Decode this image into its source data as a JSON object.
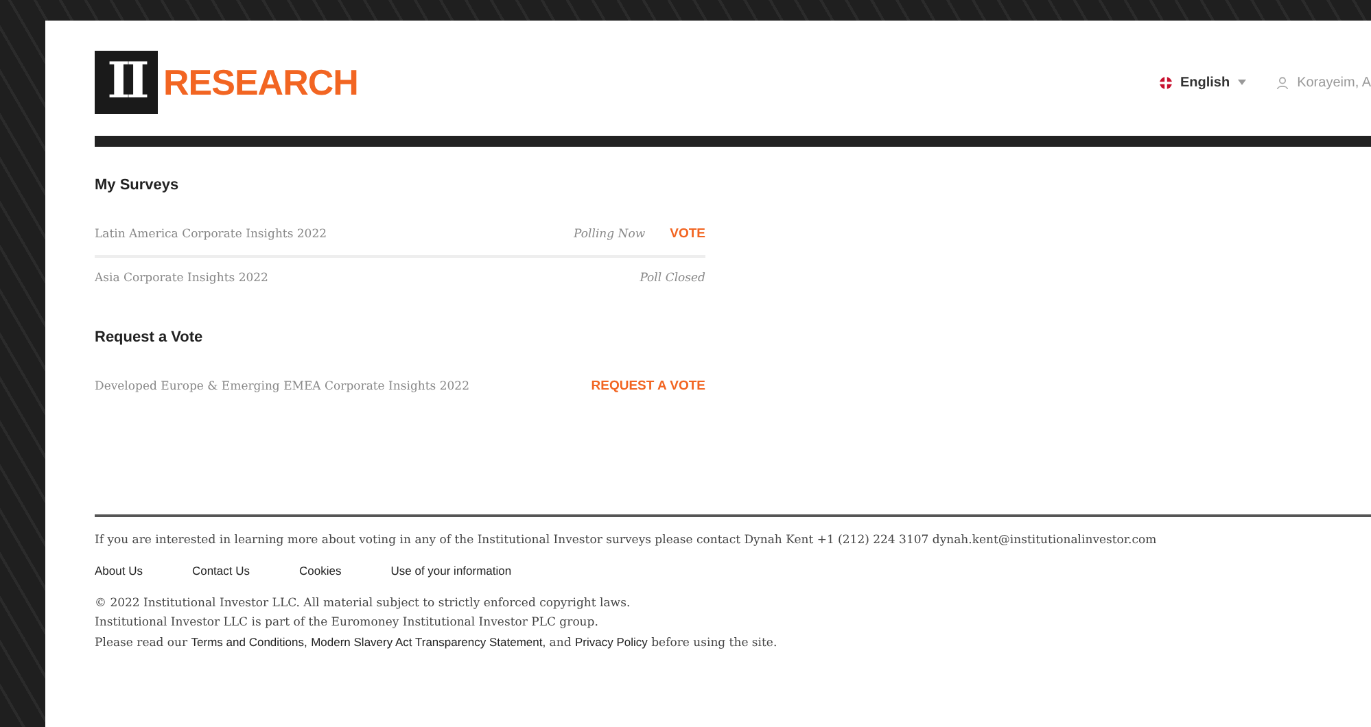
{
  "header": {
    "logo": {
      "mark": "II",
      "word": "RESEARCH"
    },
    "language": "English",
    "user": "Korayeim, A"
  },
  "my_surveys": {
    "title": "My Surveys",
    "rows": [
      {
        "name": "Latin America Corporate Insights 2022",
        "status": "Polling Now",
        "action": "VOTE"
      },
      {
        "name": "Asia Corporate Insights 2022",
        "status": "Poll Closed"
      }
    ]
  },
  "request_vote": {
    "title": "Request a Vote",
    "rows": [
      {
        "name": "Developed Europe & Emerging EMEA Corporate Insights 2022",
        "action": "REQUEST A VOTE"
      }
    ]
  },
  "footer": {
    "contact": "If you are interested in learning more about voting in any of the Institutional Investor surveys please contact Dynah Kent +1 (212) 224 3107 dynah.kent@institutionalinvestor.com",
    "links": [
      "About Us",
      "Contact Us",
      "Cookies",
      "Use of your information"
    ],
    "copyright": [
      "© 2022 Institutional Investor LLC. All material subject to strictly enforced copyright laws.",
      "Institutional Investor LLC is part of the Euromoney Institutional Investor PLC group."
    ],
    "notice": [
      {
        "kind": "text",
        "text": "Please read our "
      },
      {
        "kind": "link",
        "text": "Terms and Conditions,"
      },
      {
        "kind": "link",
        "text": "Modern Slavery Act Transparency Statement,"
      },
      {
        "kind": "text",
        "text": " and "
      },
      {
        "kind": "link",
        "text": "Privacy Policy"
      },
      {
        "kind": "text",
        "text": " before using the site."
      }
    ]
  }
}
